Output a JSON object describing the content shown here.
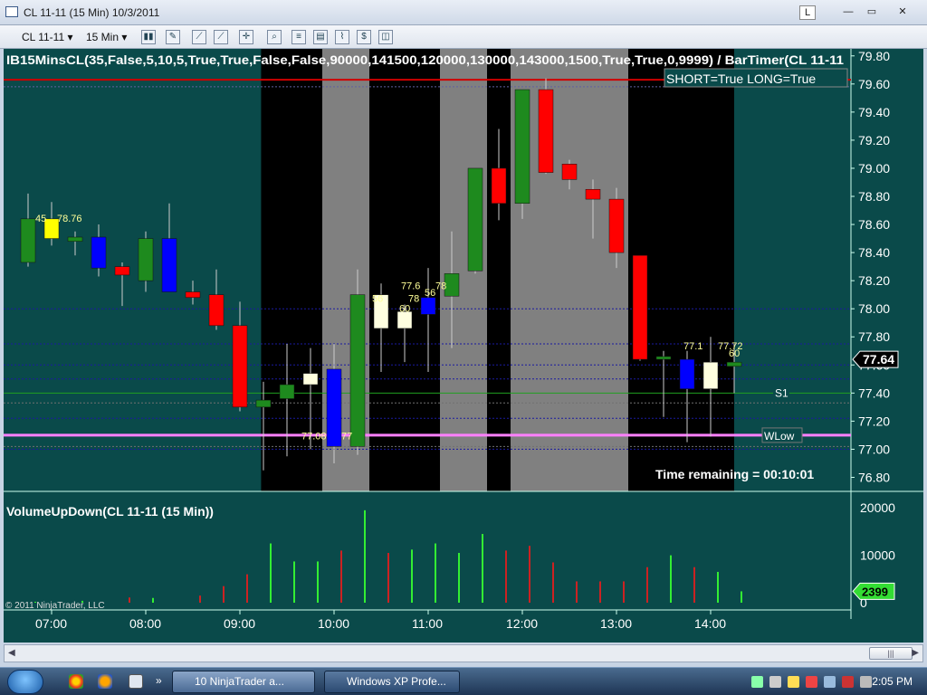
{
  "window": {
    "title": "CL 11-11 (15 Min)  10/3/2011",
    "link_btn": "L",
    "min_btn": "—",
    "max_btn": "▭",
    "close_btn": "✕"
  },
  "toolbar": {
    "instrument": "CL 11-11",
    "interval": "15 Min"
  },
  "chart": {
    "main_title": "IB15MinsCL(35,False,5,10,5,True,True,False,False,90000,141500,120000,130000,143000,1500,True,True,0,9999)  /  BarTimer(CL  11-11",
    "short_long_text": "SHORT=True LONG=True",
    "time_remaining": "Time remaining = 00:10:01",
    "last_price": "77.64",
    "s1_label": "S1",
    "wlow_label": "WLow",
    "price_labels": [
      "79.80",
      "79.60",
      "79.40",
      "79.20",
      "79.00",
      "78.80",
      "78.60",
      "78.40",
      "78.20",
      "78.00",
      "77.80",
      "77.60",
      "77.40",
      "77.20",
      "77.00",
      "76.80"
    ],
    "annotations": [
      "45",
      "78.76",
      "77.6",
      "78",
      "56",
      "78",
      "60",
      "56",
      "77.08",
      "77",
      "77.1",
      "77.72",
      "60"
    ],
    "volume_title": "VolumeUpDown(CL 11-11 (15 Min))",
    "volume_labels": [
      "20000",
      "10000",
      "0"
    ],
    "last_volume": "2399",
    "copyright": "© 2011 NinjaTrader, LLC",
    "time_labels": [
      "07:00",
      "08:00",
      "09:00",
      "10:00",
      "11:00",
      "12:00",
      "13:00",
      "14:00"
    ],
    "colors": {
      "up": "#1e8a1e",
      "down": "#ff0000",
      "upHL": "#ffffe0",
      "downHL": "#0000ff",
      "yellow": "#ffff00",
      "background": "#0a4a4a",
      "session_black": "#000000",
      "session_gray": "#808080",
      "wlow": "#ff80ff",
      "resistance": "#d00000",
      "volume_up": "#33ee33",
      "volume_down": "#cc2222"
    }
  },
  "chart_data": {
    "type": "candlestick",
    "candles": [
      {
        "o": 78.33,
        "h": 78.82,
        "l": 78.3,
        "c": 78.64,
        "color": "up"
      },
      {
        "o": 78.64,
        "h": 78.76,
        "l": 78.45,
        "c": 78.5,
        "color": "yellow"
      },
      {
        "o": 78.48,
        "h": 78.55,
        "l": 78.38,
        "c": 78.51,
        "color": "up"
      },
      {
        "o": 78.51,
        "h": 78.6,
        "l": 78.23,
        "c": 78.29,
        "color": "downHL"
      },
      {
        "o": 78.3,
        "h": 78.33,
        "l": 78.02,
        "c": 78.24,
        "color": "down"
      },
      {
        "o": 78.2,
        "h": 78.55,
        "l": 78.12,
        "c": 78.5,
        "color": "up"
      },
      {
        "o": 78.5,
        "h": 78.75,
        "l": 78.12,
        "c": 78.12,
        "color": "downHL"
      },
      {
        "o": 78.12,
        "h": 78.2,
        "l": 78.03,
        "c": 78.08,
        "color": "down"
      },
      {
        "o": 78.1,
        "h": 78.28,
        "l": 77.85,
        "c": 77.88,
        "color": "down"
      },
      {
        "o": 77.88,
        "h": 78.05,
        "l": 77.27,
        "c": 77.3,
        "color": "down"
      },
      {
        "o": 77.3,
        "h": 77.48,
        "l": 76.85,
        "c": 77.35,
        "color": "up"
      },
      {
        "o": 77.36,
        "h": 77.75,
        "l": 76.95,
        "c": 77.46,
        "color": "up"
      },
      {
        "o": 77.46,
        "h": 77.72,
        "l": 77.0,
        "c": 77.54,
        "color": "upHL"
      },
      {
        "o": 77.57,
        "h": 77.75,
        "l": 76.9,
        "c": 77.02,
        "color": "downHL"
      },
      {
        "o": 77.02,
        "h": 78.28,
        "l": 76.96,
        "c": 78.1,
        "color": "up"
      },
      {
        "o": 78.1,
        "h": 78.18,
        "l": 77.55,
        "c": 77.86,
        "color": "upHL"
      },
      {
        "o": 77.86,
        "h": 78.03,
        "l": 77.62,
        "c": 77.98,
        "color": "upHL"
      },
      {
        "o": 78.08,
        "h": 78.29,
        "l": 77.55,
        "c": 77.96,
        "color": "downHL"
      },
      {
        "o": 78.09,
        "h": 78.55,
        "l": 77.72,
        "c": 78.25,
        "color": "up"
      },
      {
        "o": 78.27,
        "h": 79.0,
        "l": 78.25,
        "c": 79.0,
        "color": "up"
      },
      {
        "o": 79.0,
        "h": 79.28,
        "l": 78.63,
        "c": 78.75,
        "color": "down"
      },
      {
        "o": 78.75,
        "h": 79.56,
        "l": 78.64,
        "c": 79.56,
        "color": "up"
      },
      {
        "o": 79.56,
        "h": 79.64,
        "l": 78.96,
        "c": 78.97,
        "color": "down"
      },
      {
        "o": 79.03,
        "h": 79.06,
        "l": 78.85,
        "c": 78.92,
        "color": "down"
      },
      {
        "o": 78.85,
        "h": 78.92,
        "l": 78.5,
        "c": 78.78,
        "color": "down"
      },
      {
        "o": 78.78,
        "h": 78.86,
        "l": 78.29,
        "c": 78.4,
        "color": "down"
      },
      {
        "o": 78.38,
        "h": 78.38,
        "l": 77.63,
        "c": 77.64,
        "color": "down"
      },
      {
        "o": 77.64,
        "h": 77.7,
        "l": 77.23,
        "c": 77.66,
        "color": "up"
      },
      {
        "o": 77.64,
        "h": 77.7,
        "l": 77.05,
        "c": 77.43,
        "color": "downHL"
      },
      {
        "o": 77.43,
        "h": 77.8,
        "l": 77.09,
        "c": 77.62,
        "color": "upHL"
      },
      {
        "o": 77.59,
        "h": 77.75,
        "l": 77.4,
        "c": 77.62,
        "color": "up"
      }
    ],
    "volume": [
      {
        "v": 200,
        "up": true
      },
      {
        "v": 0,
        "up": false
      },
      {
        "v": 400,
        "up": true
      },
      {
        "v": 0,
        "up": false
      },
      {
        "v": 1100,
        "up": false
      },
      {
        "v": 1000,
        "up": true
      },
      {
        "v": 0,
        "up": false
      },
      {
        "v": 1500,
        "up": false
      },
      {
        "v": 3500,
        "up": false
      },
      {
        "v": 6000,
        "up": false
      },
      {
        "v": 12500,
        "up": true
      },
      {
        "v": 8700,
        "up": true
      },
      {
        "v": 8700,
        "up": true
      },
      {
        "v": 11000,
        "up": false
      },
      {
        "v": 19500,
        "up": true
      },
      {
        "v": 10500,
        "up": false
      },
      {
        "v": 11200,
        "up": true
      },
      {
        "v": 12500,
        "up": true
      },
      {
        "v": 10500,
        "up": true
      },
      {
        "v": 14500,
        "up": true
      },
      {
        "v": 11000,
        "up": false
      },
      {
        "v": 12000,
        "up": false
      },
      {
        "v": 8500,
        "up": false
      },
      {
        "v": 4500,
        "up": false
      },
      {
        "v": 4500,
        "up": false
      },
      {
        "v": 4500,
        "up": false
      },
      {
        "v": 7500,
        "up": false
      },
      {
        "v": 10000,
        "up": true
      },
      {
        "v": 7500,
        "up": false
      },
      {
        "v": 6500,
        "up": true
      },
      {
        "v": 2399,
        "up": true
      }
    ],
    "ylim": [
      76.7,
      79.85
    ],
    "volume_ylim": [
      0,
      21000
    ],
    "horizontal_lines": [
      {
        "y": 79.63,
        "color": "resistance",
        "style": "solid"
      },
      {
        "y": 79.58,
        "color": "#6060a0",
        "style": "dashed"
      },
      {
        "y": 78.0,
        "color": "#1a1aa0",
        "style": "dashed"
      },
      {
        "y": 77.75,
        "color": "#1a1aa0",
        "style": "dashed"
      },
      {
        "y": 77.6,
        "color": "#1a1aa0",
        "style": "dashed"
      },
      {
        "y": 77.5,
        "color": "#1a1aa0",
        "style": "dashed"
      },
      {
        "y": 77.4,
        "color": "#20a020",
        "style": "solid"
      },
      {
        "y": 77.33,
        "color": "#707070",
        "style": "dashed"
      },
      {
        "y": 77.22,
        "color": "#1a1aa0",
        "style": "dashed"
      },
      {
        "y": 77.1,
        "color": "wlow",
        "style": "solid"
      },
      {
        "y": 77.02,
        "color": "#707070",
        "style": "dashed"
      },
      {
        "y": 77.0,
        "color": "#1a1aa0",
        "style": "dashed"
      }
    ],
    "session_bands": [
      {
        "from": 10.4,
        "to": 13.0,
        "color": "session_black"
      },
      {
        "from": 13.0,
        "to": 15.0,
        "color": "session_gray"
      },
      {
        "from": 15.0,
        "to": 18.0,
        "color": "session_black"
      },
      {
        "from": 18.0,
        "to": 20.0,
        "color": "session_gray"
      },
      {
        "from": 20.0,
        "to": 21.0,
        "color": "session_black"
      },
      {
        "from": 21.0,
        "to": 26.0,
        "color": "session_gray"
      },
      {
        "from": 26.0,
        "to": 30.5,
        "color": "session_black"
      }
    ]
  }
}
